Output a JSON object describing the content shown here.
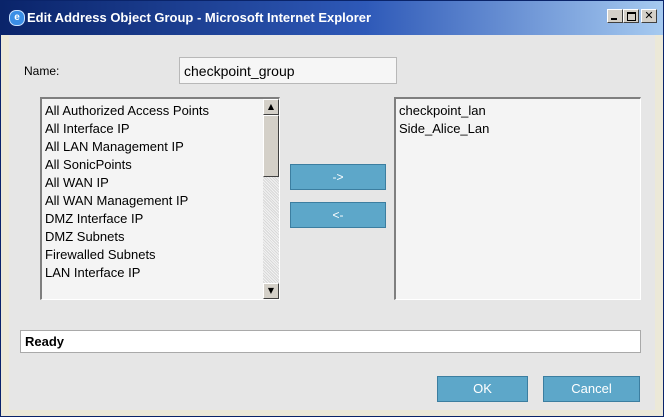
{
  "window": {
    "title": "Edit Address Object Group - Microsoft Internet Explorer",
    "icon": "internet-explorer-icon",
    "controls": {
      "minimize": "minimize",
      "maximize": "maximize",
      "close": "✕"
    }
  },
  "form": {
    "name_label": "Name:",
    "name_value": "checkpoint_group"
  },
  "available_list": {
    "items": [
      "All Authorized Access Points",
      "All Interface IP",
      "All LAN Management IP",
      "All SonicPoints",
      "All WAN IP",
      "All WAN Management IP",
      "DMZ Interface IP",
      "DMZ Subnets",
      "Firewalled Subnets",
      "LAN Interface IP"
    ],
    "scroll_up": "▲",
    "scroll_down": "▼"
  },
  "selected_list": {
    "items": [
      "checkpoint_lan",
      "Side_Alice_Lan"
    ]
  },
  "buttons": {
    "add": "->",
    "remove": "<-",
    "ok": "OK",
    "cancel": "Cancel"
  },
  "status": {
    "text": "Ready"
  },
  "colors": {
    "titlebar_start": "#0a246a",
    "button_bg": "#5da7c9",
    "dialog_bg": "#e6e6e6"
  }
}
